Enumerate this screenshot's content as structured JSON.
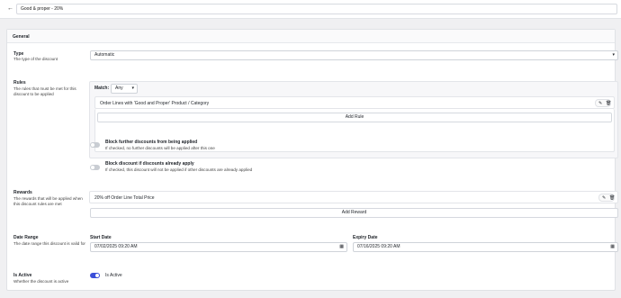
{
  "header": {
    "title": "Good & proper - 20%"
  },
  "general": {
    "title": "General"
  },
  "type_section": {
    "label": "Type",
    "description": "The type of the discount",
    "value": "Automatic"
  },
  "rules_section": {
    "label": "Rules",
    "description": "The rules that must be met for this discount to be applied",
    "match_label": "Match:",
    "match_value": "Any",
    "rules": [
      "Order Lines with 'Good and Proper' Product / Category"
    ],
    "add_rule_label": "Add Rule",
    "block_further": {
      "title": "Block further discounts from being applied",
      "description": "If checked, no further discounts will be applied after this one",
      "on": false
    },
    "block_if_applied": {
      "title": "Block discount if discounts already apply",
      "description": "If checked, this discount will not be applied if other discounts are already applied",
      "on": false
    }
  },
  "rewards_section": {
    "label": "Rewards",
    "description": "The rewards that will be applied when this discount rules are met",
    "rewards": [
      "20% off Order Line Total Price"
    ],
    "add_reward_label": "Add Reward"
  },
  "date_range": {
    "label": "Date Range",
    "description": "The date range this discount is valid for",
    "start_label": "Start Date",
    "start_value": "07/02/2025 09:20 AM",
    "expiry_label": "Expiry Date",
    "expiry_value": "07/16/2025 09:20 AM"
  },
  "is_active": {
    "label": "Is Active",
    "description": "Whether the discount is active",
    "toggle_label": "Is Active",
    "on": true
  },
  "colors": {
    "accent": "#3b4fd8",
    "background": "#f0f0f2"
  },
  "icons": {
    "back": "arrow-left-icon",
    "edit": "pencil-icon",
    "delete": "trash-icon",
    "calendar": "calendar-icon",
    "dropdown": "chevron-down-icon"
  }
}
